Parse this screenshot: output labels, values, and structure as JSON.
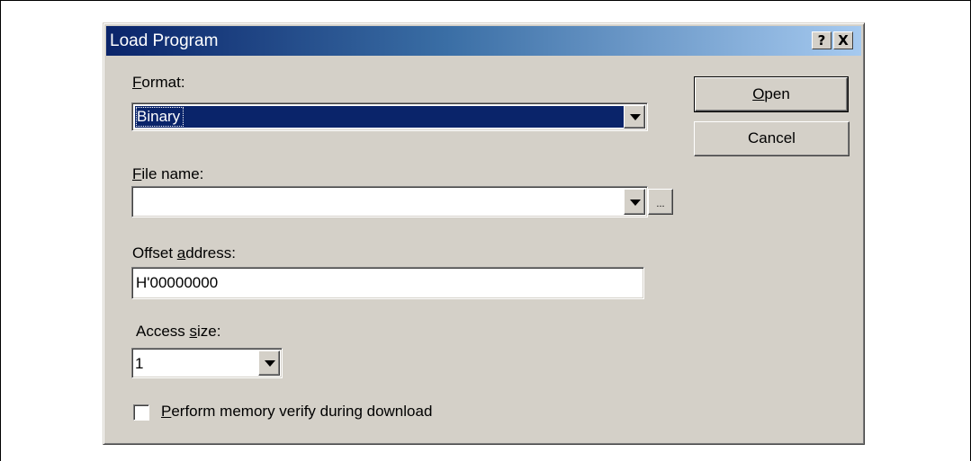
{
  "dialog": {
    "title": "Load Program",
    "help_glyph": "?",
    "close_glyph": "X"
  },
  "format": {
    "label_mnemonic": "F",
    "label_rest": "ormat:",
    "value": "Binary"
  },
  "file_name": {
    "label_mnemonic": "F",
    "label_rest": "ile name:",
    "value": "",
    "browse_label": "..."
  },
  "offset_address": {
    "label_before": "Offset ",
    "label_mnemonic": "a",
    "label_rest": "ddress:",
    "value": "H'00000000"
  },
  "access_size": {
    "label_before": "Access ",
    "label_mnemonic": "s",
    "label_rest": "ize:",
    "value": "1"
  },
  "verify": {
    "label_mnemonic": "P",
    "label_rest": "erform memory verify during download",
    "checked": false
  },
  "buttons": {
    "open_mnemonic": "O",
    "open_rest": "pen",
    "cancel": "Cancel"
  }
}
